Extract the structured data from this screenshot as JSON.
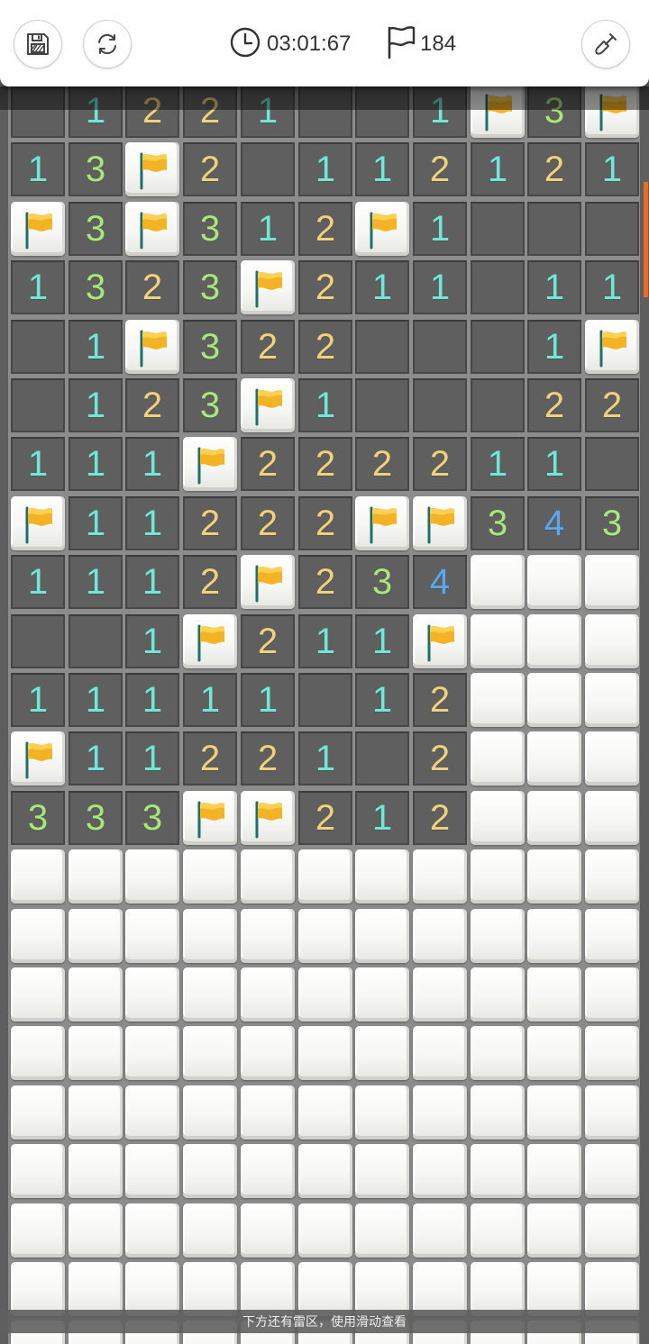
{
  "toolbar": {
    "save_icon": "floppy-disk-icon",
    "restart_icon": "refresh-icon",
    "tool_icon": "shovel-icon"
  },
  "status": {
    "timer": "03:01:67",
    "timer_icon": "clock-icon",
    "flags_remaining": "184",
    "flag_icon": "flag-outline-icon"
  },
  "hint": "下方还有雷区，使用滑动查看",
  "colors": {
    "1": "#6fe8d8",
    "2": "#f0d27a",
    "3": "#a8e87a",
    "4": "#5aa8f0",
    "flag": "#f4b324",
    "scroll_thumb": "#f06a1c"
  },
  "board": {
    "columns": 11,
    "legend": "0 = open empty, digit = open number, F = flag, C = covered",
    "rows": [
      "01221001F3F",
      "13F20112121",
      "F3F312F1000",
      "1323F211011",
      "01F3220001F",
      "0123F100022",
      "111F2222110",
      "F11222FF343",
      "1112F234CCC",
      "001F211FCCC",
      "11111012CCC",
      "F1122102CCC",
      "333FF212CCC",
      "CCCCCCCCCCC",
      "CCCCCCCCCCC",
      "CCCCCCCCCCC",
      "CCCCCCCCCCC",
      "CCCCCCCCCCC",
      "CCCCCCCCCCC",
      "CCCCCCCCCCC",
      "CCCCCCCCCCC",
      "CCCCCCCCCCC"
    ]
  }
}
